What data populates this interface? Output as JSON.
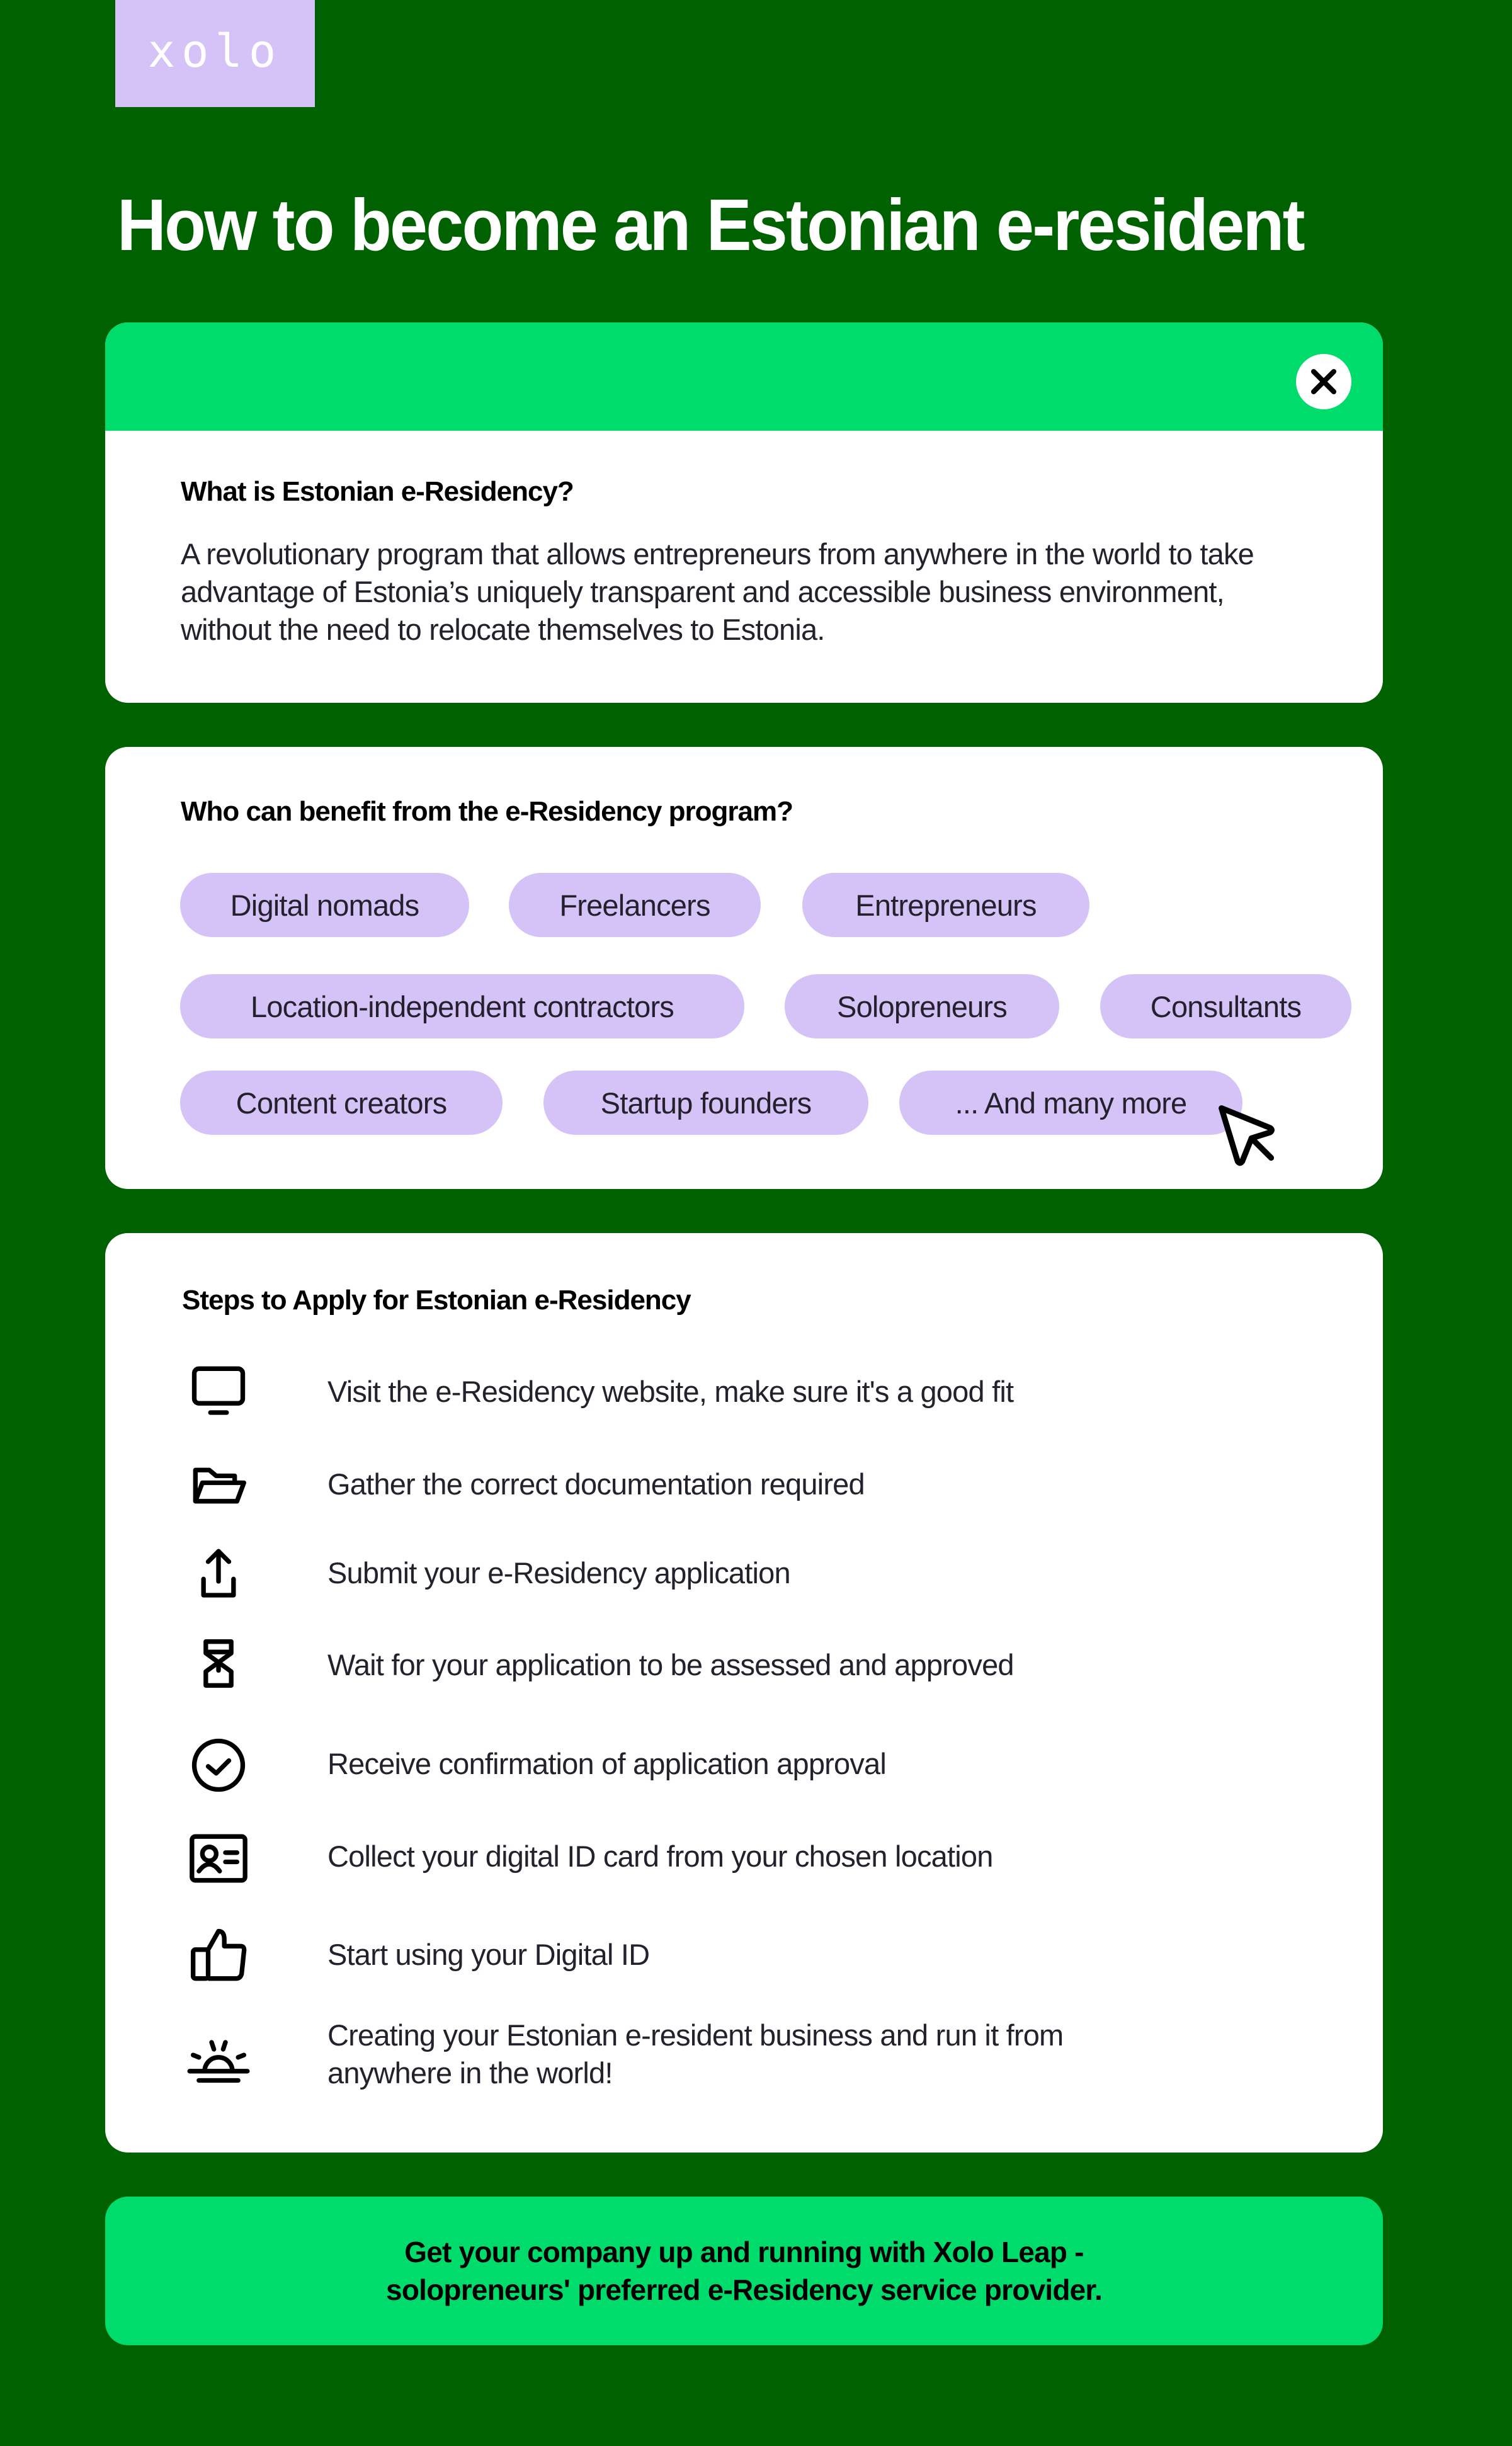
{
  "logo": {
    "text": "xolo"
  },
  "title": "How to become an Estonian e-resident",
  "colors": {
    "background": "#006100",
    "accent_green": "#00dc6c",
    "pill_lavender": "#d5c3f7",
    "card": "#ffffff",
    "text": "#1c1a24"
  },
  "what_is": {
    "close_icon": "close-icon",
    "heading": "What is Estonian e-Residency?",
    "description": "A revolutionary program that allows entrepreneurs from anywhere in the world to take advantage of Estonia’s uniquely transparent and accessible business environment, without the need to relocate themselves to Estonia."
  },
  "who_can_benefit": {
    "heading": "Who can benefit from the e-Residency program?",
    "tags": [
      "Digital nomads",
      "Freelancers",
      "Entrepreneurs",
      "Location-independent contractors",
      "Solopreneurs",
      "Consultants",
      "Content creators",
      "Startup founders",
      "... And many more"
    ],
    "cursor_icon": "mouse-pointer-icon"
  },
  "steps": {
    "heading": "Steps to Apply for Estonian e-Residency",
    "items": [
      {
        "icon": "monitor-icon",
        "text": "Visit the e-Residency website, make sure it's a good fit"
      },
      {
        "icon": "folder-open-icon",
        "text": "Gather the correct documentation required"
      },
      {
        "icon": "upload-icon",
        "text": "Submit your e-Residency application"
      },
      {
        "icon": "hourglass-icon",
        "text": "Wait for your application to be assessed and approved"
      },
      {
        "icon": "check-circle-icon",
        "text": "Receive confirmation of application approval"
      },
      {
        "icon": "id-card-icon",
        "text": "Collect your digital ID card from your chosen location"
      },
      {
        "icon": "thumbs-up-icon",
        "text": "Start using your Digital ID"
      },
      {
        "icon": "sunrise-icon",
        "text": "Creating your Estonian e-resident business and run it from anywhere in the world!"
      }
    ]
  },
  "cta": {
    "line1": "Get your company up and running with Xolo Leap -",
    "line2": "solopreneurs' preferred e-Residency service provider."
  }
}
